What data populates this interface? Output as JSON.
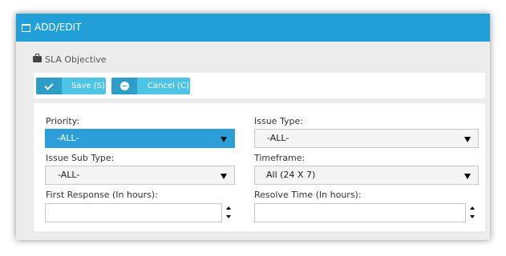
{
  "header": {
    "title": "ADD/EDIT",
    "icon": "window-icon"
  },
  "section": {
    "title": "SLA Objective",
    "icon": "briefcase-icon"
  },
  "toolbar": {
    "save_label": "Save (S)",
    "cancel_label": "Cancel (C)"
  },
  "form": {
    "priority": {
      "label": "Priority:",
      "value": "-ALL-"
    },
    "issue_type": {
      "label": "Issue Type:",
      "value": "-ALL-"
    },
    "issue_sub_type": {
      "label": "Issue Sub Type:",
      "value": "-ALL-"
    },
    "timeframe": {
      "label": "Timeframe:",
      "value": "All (24 X 7)"
    },
    "first_response": {
      "label": "First Response (In hours):",
      "value": ""
    },
    "resolve_time": {
      "label": "Resolve Time (In hours):",
      "value": ""
    }
  },
  "colors": {
    "header_bg": "#229fd7",
    "button_bg": "#4dc3e6",
    "button_icon_bg": "#2e9ec6",
    "active_select_bg": "#2c9fd8"
  }
}
